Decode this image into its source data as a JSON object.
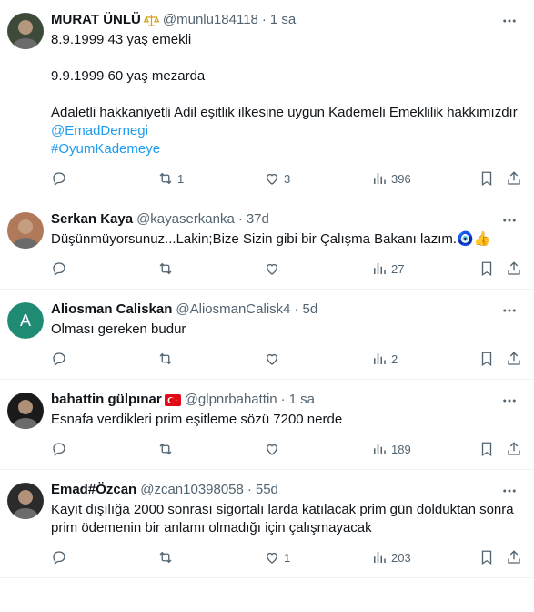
{
  "tweets": [
    {
      "name": "MURAT ÜNLÜ",
      "handle": "@munlu184118",
      "time": "1 sa",
      "badge": "scales-emoji",
      "lines": [
        "8.9.1999 43 yaş emekli",
        "",
        "9.9.1999 60 yaş mezarda",
        "",
        "Adaletli hakkaniyetli Adil eşitlik ilkesine uygun Kademeli Emeklilik hakkımızdır"
      ],
      "links": [
        "@EmadDernegi",
        "#OyumKademeye"
      ],
      "stats": {
        "replies": "",
        "retweets": "1",
        "likes": "3",
        "views": "396"
      },
      "avatar_color": "#3d4a3a"
    },
    {
      "name": "Serkan Kaya",
      "handle": "@kayaserkanka",
      "time": "37d",
      "lines": [
        "Düşünmüyorsunuz...Lakin;Bize Sizin gibi bir Çalışma Bakanı lazım.🧿👍"
      ],
      "links": [],
      "stats": {
        "replies": "",
        "retweets": "",
        "likes": "",
        "views": "27"
      },
      "avatar_color": "#b07a5a"
    },
    {
      "name": "Aliosman Caliskan",
      "handle": "@AliosmanCalisk4",
      "time": "5d",
      "avatar_letter": "A",
      "lines": [
        "Olması gereken budur"
      ],
      "links": [],
      "stats": {
        "replies": "",
        "retweets": "",
        "likes": "",
        "views": "2"
      },
      "avatar_color": "#1e8b72"
    },
    {
      "name": "bahattin gülpınar",
      "handle": "@glpnrbahattin",
      "time": "1 sa",
      "badge": "turkey-flag",
      "lines": [
        "Esnafa verdikleri prim eşitleme sözü 7200 nerde"
      ],
      "links": [],
      "stats": {
        "replies": "",
        "retweets": "",
        "likes": "",
        "views": "189"
      },
      "avatar_color": "#1a1a1a"
    },
    {
      "name": "Emad#Özcan",
      "handle": "@zcan10398058",
      "time": "55d",
      "lines": [
        "Kayıt dışılığa 2000 sonrası sigortalı larda katılacak prim gün dolduktan sonra prim ödemenin bir anlamı olmadığı için çalışmayacak"
      ],
      "links": [],
      "stats": {
        "replies": "",
        "retweets": "",
        "likes": "1",
        "views": "203"
      },
      "avatar_color": "#2b2b2b"
    }
  ],
  "colors": {
    "text": "#0f1419",
    "muted": "#536471",
    "link": "#1d9bf0",
    "divider": "#eff3f4"
  },
  "icons": [
    "more-icon",
    "reply-icon",
    "retweet-icon",
    "like-icon",
    "views-icon",
    "bookmark-icon",
    "share-icon"
  ]
}
